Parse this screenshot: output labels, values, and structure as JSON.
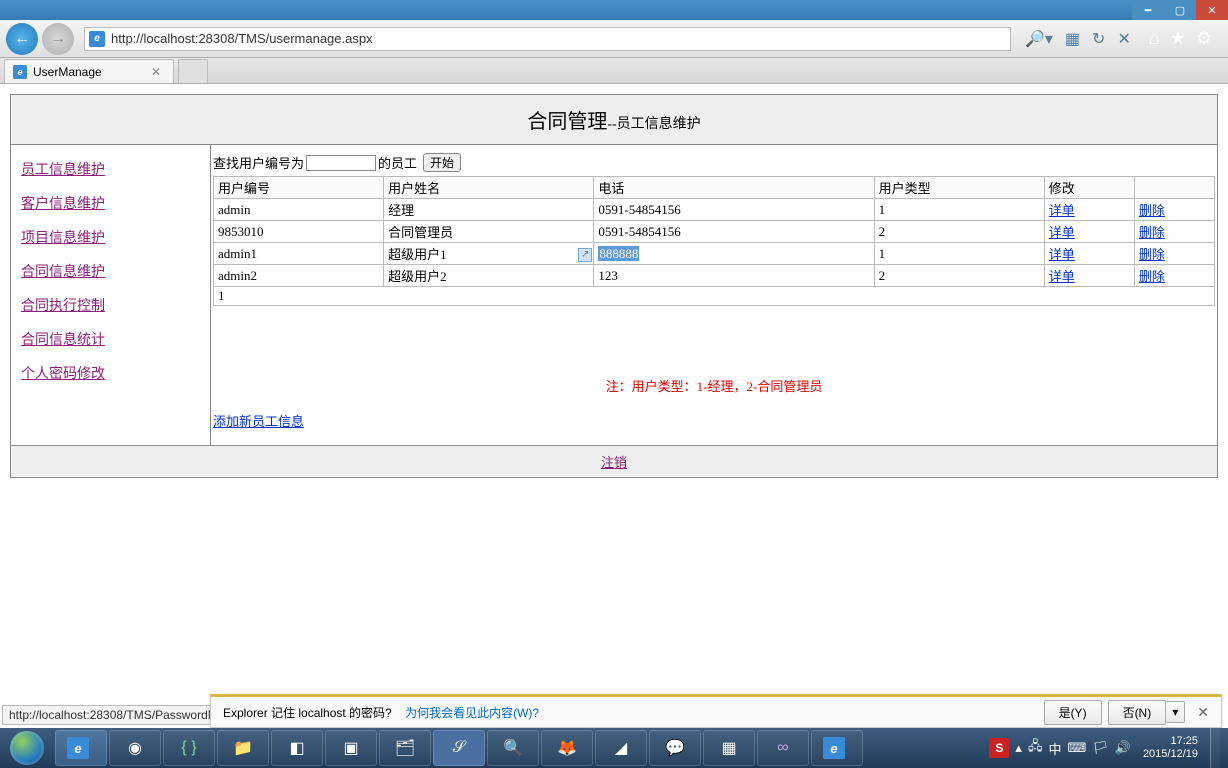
{
  "window": {
    "title_tab": "UserManage"
  },
  "browser": {
    "url": "http://localhost:28308/TMS/usermanage.aspx",
    "hover_url": "http://localhost:28308/TMS/PasswordModifyForAdmin.aspx"
  },
  "page": {
    "heading_main": "合同管理",
    "heading_sub": "--员工信息维护",
    "sidebar": [
      "员工信息维护",
      "客户信息维护",
      "项目信息维护",
      "合同信息维护",
      "合同执行控制",
      "合同信息统计",
      "个人密码修改"
    ],
    "search": {
      "prefix": "查找用户编号为",
      "suffix": "的员工",
      "value": "",
      "button": "开始"
    },
    "table": {
      "headers": [
        "用户编号",
        "用户姓名",
        "电话",
        "用户类型",
        "修改",
        ""
      ],
      "rows": [
        {
          "id": "admin",
          "name": "经理",
          "phone": "0591-54854156",
          "type": "1",
          "detail": "详单",
          "delete": "删除"
        },
        {
          "id": "9853010",
          "name": "合同管理员",
          "phone": "0591-54854156",
          "type": "2",
          "detail": "详单",
          "delete": "删除"
        },
        {
          "id": "admin1",
          "name": "超级用户1",
          "phone": "888888",
          "type": "1",
          "detail": "详单",
          "delete": "删除",
          "phone_selected": true
        },
        {
          "id": "admin2",
          "name": "超级用户2",
          "phone": "123",
          "type": "2",
          "detail": "详单",
          "delete": "删除"
        }
      ],
      "page_number": "1"
    },
    "note": "注：用户类型：1-经理，2-合同管理员",
    "add_link": "添加新员工信息",
    "footer_link": "注销"
  },
  "ie_prompt": {
    "msg_prefix": "Explorer 记住 localhost 的密码?",
    "why": "为何我会看见此内容(W)?",
    "yes": "是(Y)",
    "no": "否(N)"
  },
  "system": {
    "time": "17:25",
    "date": "2015/12/19"
  }
}
